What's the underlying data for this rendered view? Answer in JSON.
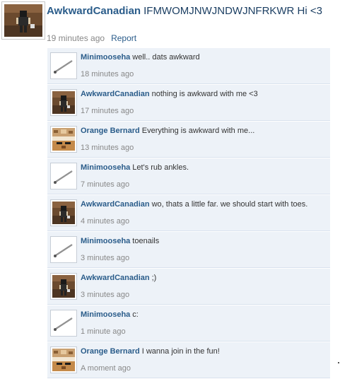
{
  "post": {
    "author": "AwkwardCanadian",
    "text": "IFMWOMJNWJNDWJNFRKWR Hi <3",
    "time": "19 minutes ago",
    "report_label": "Report"
  },
  "comments": [
    {
      "author": "Minimooseha",
      "text": "well.. dats awkward",
      "time": "18 minutes ago",
      "avatar": "pin-avatar"
    },
    {
      "author": "AwkwardCanadian",
      "text": "nothing is awkward with me <3",
      "time": "17 minutes ago",
      "avatar": "figure-avatar"
    },
    {
      "author": "Orange Bernard",
      "text": "Everything is awkward with me...",
      "time": "13 minutes ago",
      "avatar": "tan-avatar"
    },
    {
      "author": "Minimooseha",
      "text": "Let's rub ankles.",
      "time": "7 minutes ago",
      "avatar": "pin-avatar"
    },
    {
      "author": "AwkwardCanadian",
      "text": "wo, thats a little far. we should start with toes.",
      "time": "4 minutes ago",
      "avatar": "figure-avatar"
    },
    {
      "author": "Minimooseha",
      "text": "toenails",
      "time": "3 minutes ago",
      "avatar": "pin-avatar"
    },
    {
      "author": "AwkwardCanadian",
      "text": ";)",
      "time": "3 minutes ago",
      "avatar": "figure-avatar"
    },
    {
      "author": "Minimooseha",
      "text": "c:",
      "time": "1 minute ago",
      "avatar": "pin-avatar"
    },
    {
      "author": "Orange Bernard",
      "text": "I wanna join in the fun!",
      "time": "A moment ago",
      "avatar": "tan-avatar"
    }
  ]
}
